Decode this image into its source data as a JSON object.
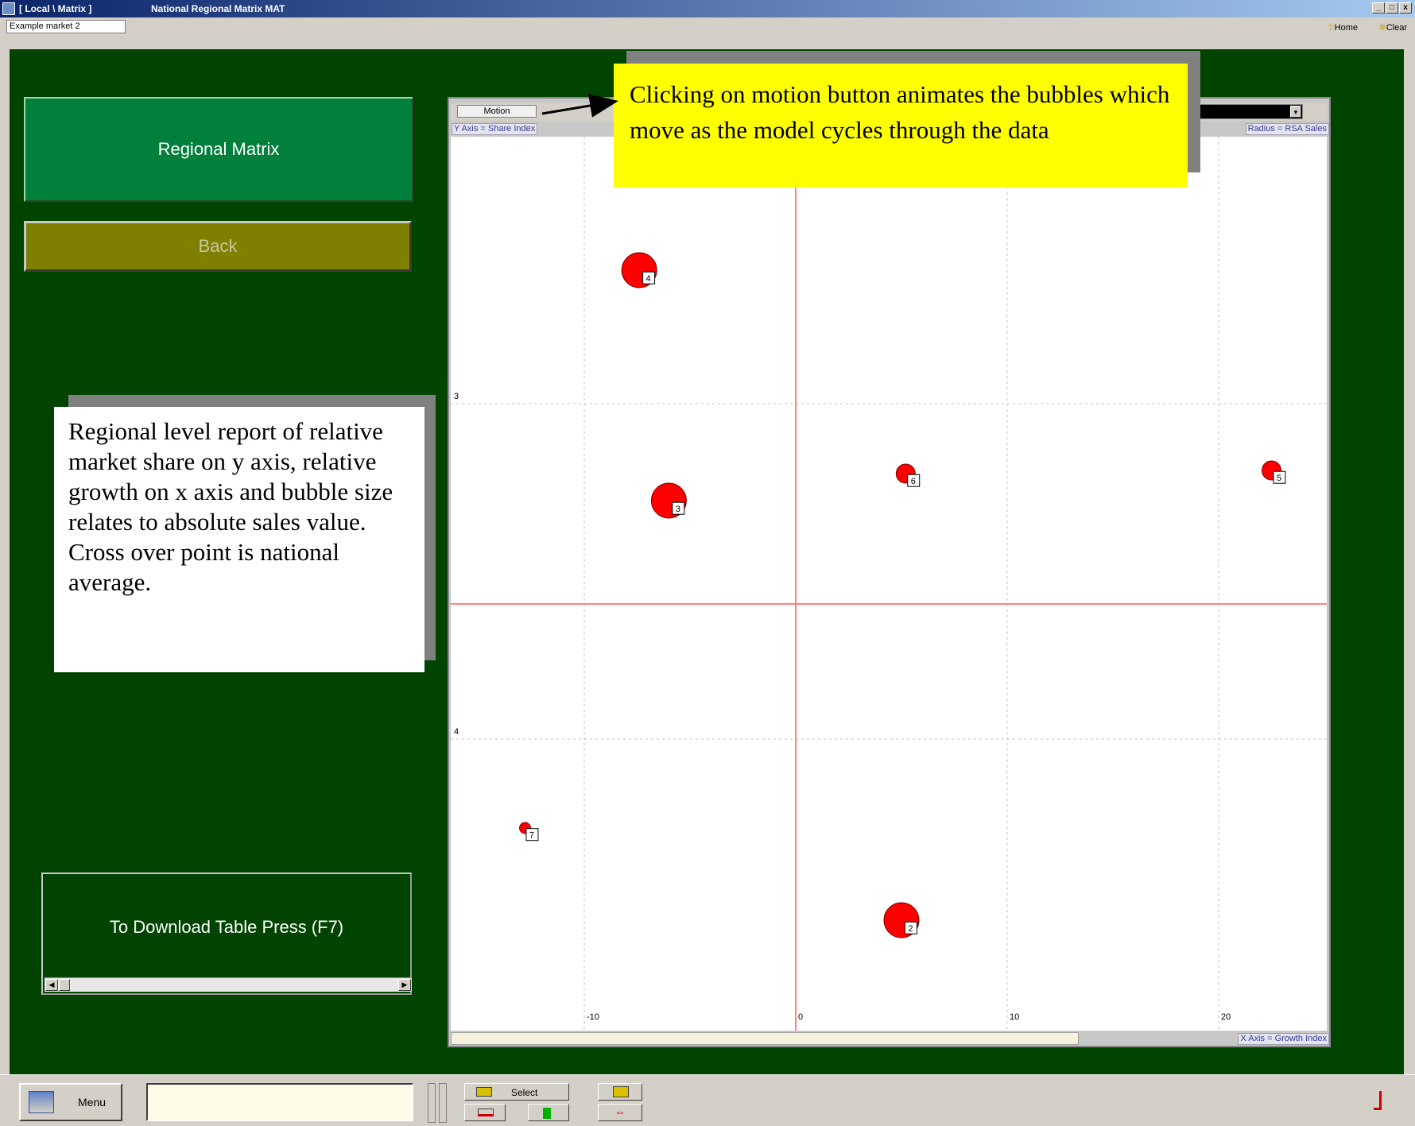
{
  "window": {
    "path": "[ Local \\ Matrix ]",
    "title": "National Regional Matrix MAT",
    "buttons": [
      "_",
      "□",
      "x"
    ]
  },
  "topbar": {
    "market": "Example market 2",
    "home": "Home",
    "clear": "Clear"
  },
  "panel": {
    "title": "Regional Matrix",
    "back": "Back",
    "download": "To Download Table Press (F7)"
  },
  "notes": {
    "left": "Regional level report of relative market share on y axis, relative growth on x axis and bubble size relates to absolute sales value. Cross over point is national average.",
    "top": "Clicking on motion button animates the bubbles which move as the model cycles through the data"
  },
  "chart": {
    "motion_label": "Motion",
    "y_axis_label": "Y Axis = Share Index",
    "radius_label": "Radius = RSA Sales",
    "x_axis_label": "X Axis = Growth Index"
  },
  "chart_data": {
    "type": "scatter",
    "xlabel": "X Axis = Growth Index",
    "ylabel": "Y Axis = Share Index",
    "radius_label": "Radius = RSA Sales",
    "x_ticks": [
      "-10",
      "0",
      "10",
      "20"
    ],
    "y_ticks": [
      "3",
      "4"
    ],
    "x_gridlines": [
      -10,
      0,
      10,
      20
    ],
    "points": [
      {
        "label": "4",
        "x": -7.4,
        "size": "large"
      },
      {
        "label": "3",
        "x": -6.0,
        "size": "large"
      },
      {
        "label": "6",
        "x": 5.2,
        "size": "small"
      },
      {
        "label": "5",
        "x": 22.5,
        "size": "small"
      },
      {
        "label": "7",
        "x": -12.8,
        "size": "tiny"
      },
      {
        "label": "2",
        "x": 5.0,
        "size": "large"
      }
    ],
    "colors": {
      "bubble": "#ff0000",
      "crosshair": "#ff8080",
      "grid": "#c0c0c0"
    }
  },
  "statusbar": {
    "menu": "Menu",
    "select": "Select"
  }
}
